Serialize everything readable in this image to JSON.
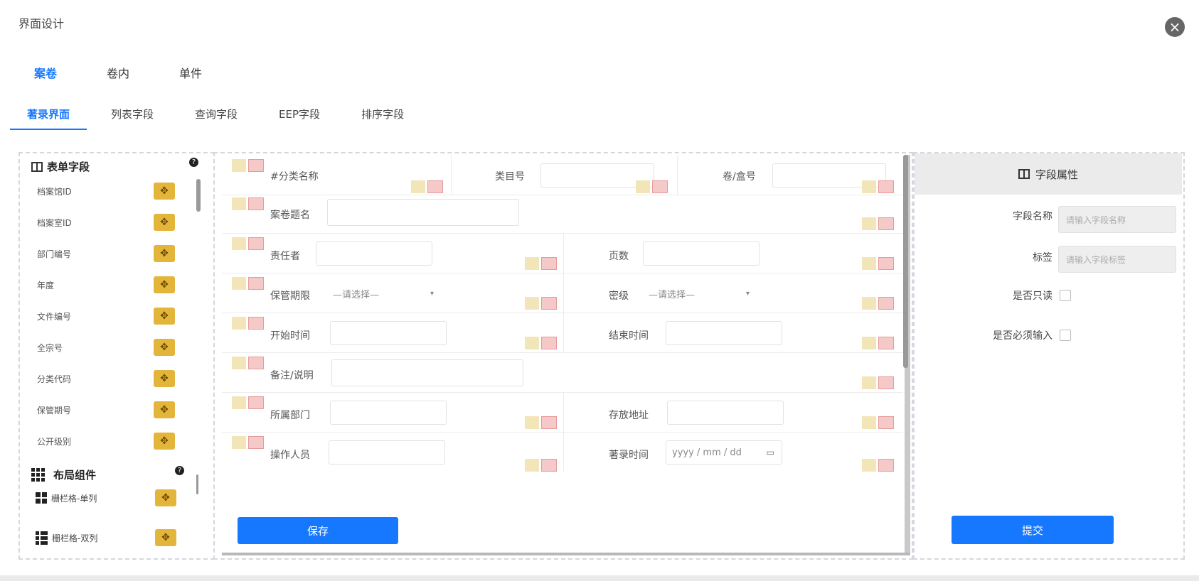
{
  "window": {
    "title": "界面设计"
  },
  "top_tabs": [
    {
      "label": "案卷",
      "active": true
    },
    {
      "label": "卷内",
      "active": false
    },
    {
      "label": "单件",
      "active": false
    }
  ],
  "sub_tabs": [
    {
      "label": "著录界面",
      "active": true
    },
    {
      "label": "列表字段",
      "active": false
    },
    {
      "label": "查询字段",
      "active": false
    },
    {
      "label": "EEP字段",
      "active": false
    },
    {
      "label": "排序字段",
      "active": false
    }
  ],
  "left": {
    "form_fields_title": "表单字段",
    "form_fields": [
      "档案馆ID",
      "档案室ID",
      "部门编号",
      "年度",
      "文件编号",
      "全宗号",
      "分类代码",
      "保管期号",
      "公开级别"
    ],
    "layout_title": "布局组件",
    "layout_items": [
      "栅栏格-单列",
      "栅栏格-双列"
    ]
  },
  "form": {
    "rows": [
      {
        "cells": [
          {
            "label": "#分类名称",
            "value": ""
          },
          {
            "label": "类目号",
            "value": ""
          },
          {
            "label": "卷/盒号",
            "value": ""
          }
        ]
      },
      {
        "cells": [
          {
            "label": "案卷题名",
            "value": ""
          }
        ]
      },
      {
        "cells": [
          {
            "label": "责任者",
            "value": ""
          },
          {
            "label": "页数",
            "value": ""
          }
        ]
      },
      {
        "cells": [
          {
            "label": "保管期限",
            "value": "—请选择—"
          },
          {
            "label": "密级",
            "value": "—请选择—"
          }
        ]
      },
      {
        "cells": [
          {
            "label": "开始时间",
            "value": ""
          },
          {
            "label": "结束时间",
            "value": ""
          }
        ]
      },
      {
        "cells": [
          {
            "label": "备注/说明",
            "value": ""
          }
        ]
      },
      {
        "cells": [
          {
            "label": "所属部门",
            "value": ""
          },
          {
            "label": "存放地址",
            "value": ""
          }
        ]
      },
      {
        "cells": [
          {
            "label": "操作人员",
            "value": ""
          },
          {
            "label": "著录时间",
            "value": "yyyy / mm / dd"
          }
        ]
      }
    ],
    "save_label": "保存"
  },
  "properties": {
    "title": "字段属性",
    "field_name_label": "字段名称",
    "field_name_placeholder": "请输入字段名称",
    "title_label": "标签",
    "title_placeholder": "请输入字段标签",
    "readonly_label": "是否只读",
    "required_label": "是否必须输入",
    "submit_label": "提交"
  },
  "colors": {
    "accent": "#1677ff",
    "drag": "#e3b53a"
  }
}
